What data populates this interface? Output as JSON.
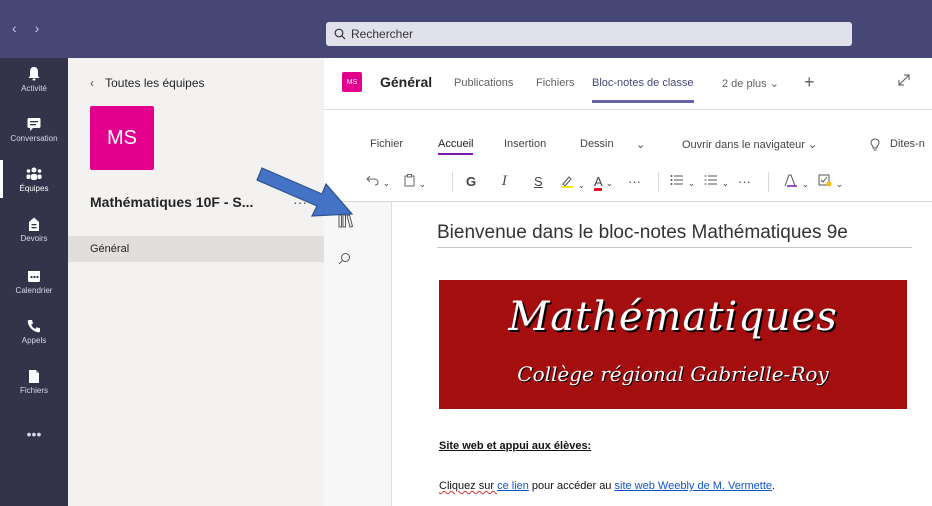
{
  "topbar": {
    "back_arrow": "‹",
    "forward_arrow": "›",
    "search_placeholder": "Rechercher"
  },
  "rail": {
    "items": [
      {
        "label": "Activité",
        "icon": "bell-icon"
      },
      {
        "label": "Conversation",
        "icon": "chat-icon"
      },
      {
        "label": "Équipes",
        "icon": "teams-icon"
      },
      {
        "label": "Devoirs",
        "icon": "assignments-icon"
      },
      {
        "label": "Calendrier",
        "icon": "calendar-icon"
      },
      {
        "label": "Appels",
        "icon": "phone-icon"
      },
      {
        "label": "Fichiers",
        "icon": "file-icon"
      }
    ],
    "more_label": "•••",
    "active_index": 2
  },
  "team": {
    "back_label": "Toutes les équipes",
    "avatar_text": "MS",
    "name": "Mathématiques 10F - S...",
    "more": "···",
    "channels": [
      "Général"
    ]
  },
  "channel_header": {
    "avatar_text": "MS",
    "title": "Général",
    "tabs": [
      "Publications",
      "Fichiers",
      "Bloc-notes de classe",
      "2 de plus ⌄"
    ],
    "active_tab": "Bloc-notes de classe",
    "add_tab": "+"
  },
  "ribbon": {
    "tabs": [
      "Fichier",
      "Accueil",
      "Insertion",
      "Dessin",
      "⌄",
      "Ouvrir dans le navigateur ⌄",
      "Dites-n"
    ],
    "active_tab": "Accueil",
    "tools": {
      "undo": "⟲⌄",
      "paste": "📋⌄",
      "bold": "G",
      "italic": "I",
      "underline": "S",
      "highlight": "⌄",
      "font_color": "⌄",
      "more1": "···",
      "bullets": "⌄",
      "numbering": "⌄",
      "more2": "···",
      "styles": "⌄",
      "tags": "⌄"
    },
    "accent_color": "#7719aa"
  },
  "page": {
    "title": "Bienvenue dans le bloc-notes Mathématiques 9e",
    "banner_line1": "Mathématiques",
    "banner_line2": "Collège régional Gabrielle-Roy",
    "banner_color": "#a50e0e",
    "heading": "Site web et appui aux élèves:",
    "para_prefix": "Cliquez sur ",
    "para_link1": "ce lien",
    "para_mid": " pour accéder au ",
    "para_link2": "site web Weebly de M. Vermette",
    "para_suffix": "."
  },
  "colors": {
    "topbar": "#464775",
    "rail": "#33344a",
    "team_avatar": "#e3008c",
    "active_tab_underline": "#6264a7",
    "annotation_arrow": "#4472c4"
  }
}
